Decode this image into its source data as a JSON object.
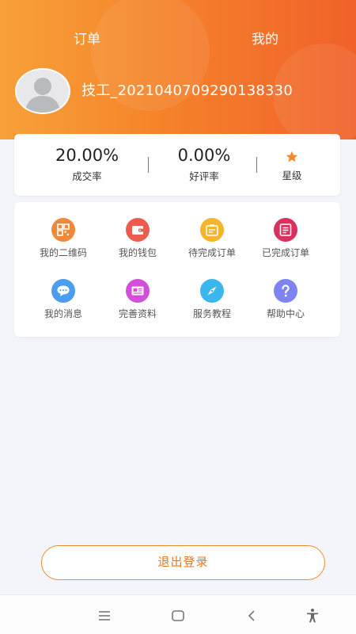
{
  "header": {
    "tabs": [
      {
        "label": "订单"
      },
      {
        "label": "我的"
      }
    ],
    "username": "技工_2021040709290138330"
  },
  "stats": [
    {
      "value": "20.00%",
      "label": "成交率"
    },
    {
      "value": "0.00%",
      "label": "好评率"
    },
    {
      "label": "星级",
      "icon": "star-icon"
    }
  ],
  "grid": [
    {
      "label": "我的二维码",
      "icon": "qr-code-icon",
      "color": "#ef8a3c"
    },
    {
      "label": "我的钱包",
      "icon": "wallet-icon",
      "color": "#ec5b4f"
    },
    {
      "label": "待完成订单",
      "icon": "pending-order-icon",
      "color": "#f6b42a"
    },
    {
      "label": "已完成订单",
      "icon": "completed-order-icon",
      "color": "#d8315f"
    },
    {
      "label": "我的消息",
      "icon": "message-icon",
      "color": "#4c9df0"
    },
    {
      "label": "完善资料",
      "icon": "profile-card-icon",
      "color": "#d24fd8"
    },
    {
      "label": "服务教程",
      "icon": "compass-icon",
      "color": "#39b7ee"
    },
    {
      "label": "帮助中心",
      "icon": "help-icon",
      "color": "#7d84f2"
    }
  ],
  "logout_label": "退出登录",
  "theme": {
    "accent": "#f5832a",
    "background": "#f3f5fa"
  },
  "system_nav": [
    "menu-icon",
    "home-icon",
    "back-icon",
    "accessibility-icon"
  ]
}
